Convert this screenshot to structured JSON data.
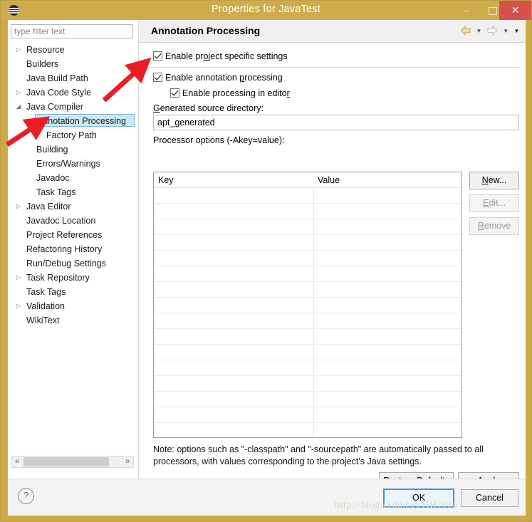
{
  "window": {
    "title": "Properties for JavaTest",
    "icon": "eclipse-icon",
    "minimize_label": "–",
    "maximize_label": "maximize-icon",
    "close_label": "✕",
    "accent_color": "#cfab4c",
    "close_color": "#d6504c"
  },
  "sidebar": {
    "filter": {
      "value": "",
      "placeholder": "type filter text"
    },
    "items": [
      {
        "label": "Resource",
        "indent": 1,
        "twisty": "collapsed",
        "selected": false
      },
      {
        "label": "Builders",
        "indent": 1,
        "twisty": "none",
        "selected": false
      },
      {
        "label": "Java Build Path",
        "indent": 1,
        "twisty": "none",
        "selected": false
      },
      {
        "label": "Java Code Style",
        "indent": 1,
        "twisty": "collapsed",
        "selected": false
      },
      {
        "label": "Java Compiler",
        "indent": 1,
        "twisty": "expanded",
        "selected": false
      },
      {
        "label": "Annotation Processing",
        "indent": 2,
        "twisty": "expanded",
        "selected": true
      },
      {
        "label": "Factory Path",
        "indent": 3,
        "twisty": "none",
        "selected": false
      },
      {
        "label": "Building",
        "indent": 2,
        "twisty": "none",
        "selected": false
      },
      {
        "label": "Errors/Warnings",
        "indent": 2,
        "twisty": "none",
        "selected": false
      },
      {
        "label": "Javadoc",
        "indent": 2,
        "twisty": "none",
        "selected": false
      },
      {
        "label": "Task Tags",
        "indent": 2,
        "twisty": "none",
        "selected": false
      },
      {
        "label": "Java Editor",
        "indent": 1,
        "twisty": "collapsed",
        "selected": false
      },
      {
        "label": "Javadoc Location",
        "indent": 1,
        "twisty": "none",
        "selected": false
      },
      {
        "label": "Project References",
        "indent": 1,
        "twisty": "none",
        "selected": false
      },
      {
        "label": "Refactoring History",
        "indent": 1,
        "twisty": "none",
        "selected": false
      },
      {
        "label": "Run/Debug Settings",
        "indent": 1,
        "twisty": "none",
        "selected": false
      },
      {
        "label": "Task Repository",
        "indent": 1,
        "twisty": "collapsed",
        "selected": false
      },
      {
        "label": "Task Tags",
        "indent": 1,
        "twisty": "none",
        "selected": false
      },
      {
        "label": "Validation",
        "indent": 1,
        "twisty": "collapsed",
        "selected": false
      },
      {
        "label": "WikiText",
        "indent": 1,
        "twisty": "none",
        "selected": false
      }
    ],
    "scrollbar": {
      "left_arrow": "«",
      "right_arrow": "»"
    }
  },
  "page": {
    "title": "Annotation Processing",
    "nav": {
      "back_icon": "back-arrow-icon",
      "back_menu_icon": "chevron-down-icon",
      "forward_icon": "forward-arrow-icon",
      "forward_menu_icon": "chevron-down-icon",
      "menu_icon": "chevron-down-icon"
    },
    "checkboxes": {
      "project_specific": {
        "label": "Enable project specific settings",
        "checked": true,
        "mnemonic": "o"
      },
      "annotation_processing": {
        "label": "Enable annotation processing",
        "checked": true,
        "mnemonic": "p"
      },
      "processing_in_editor": {
        "label": "Enable processing in editor",
        "checked": true,
        "mnemonic": "r"
      }
    },
    "generated_dir": {
      "label": "Generated source directory:",
      "value": "apt_generated"
    },
    "processor_options": {
      "label": "Processor options (-Akey=value):",
      "columns": [
        "Key",
        "Value"
      ],
      "rows": [],
      "row_count": 16
    },
    "side_buttons": [
      {
        "label": "New...",
        "enabled": true,
        "mnemonic": "N"
      },
      {
        "label": "Edit...",
        "enabled": false,
        "mnemonic": "E"
      },
      {
        "label": "Remove",
        "enabled": false,
        "mnemonic": "R"
      }
    ],
    "note": "Note: options such as \"-classpath\" and \"-sourcepath\" are automatically passed to all processors, with values corresponding to the project's Java settings.",
    "page_buttons": [
      {
        "label": "Restore Defaults",
        "enabled": true
      },
      {
        "label": "Apply",
        "enabled": true
      }
    ]
  },
  "footer": {
    "help_icon": "question-mark-icon",
    "ok_label": "OK",
    "cancel_label": "Cancel"
  },
  "watermark": "http://blog.csdn.net/HHcoco"
}
